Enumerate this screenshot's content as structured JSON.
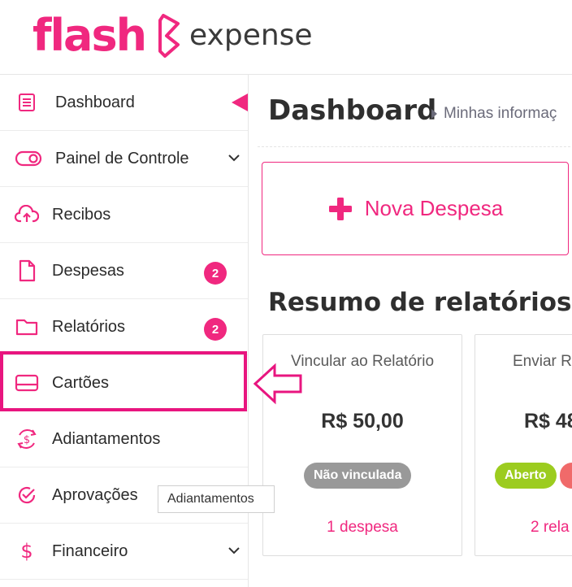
{
  "brand": {
    "name": "flash",
    "product": "expense",
    "accent": "#f0287f"
  },
  "sidebar": {
    "items": [
      {
        "label": "Dashboard",
        "icon": "list-icon"
      },
      {
        "label": "Painel de Controle",
        "icon": "toggle-icon"
      },
      {
        "label": "Recibos",
        "icon": "cloud-upload-icon"
      },
      {
        "label": "Despesas",
        "icon": "document-icon",
        "badge": "2"
      },
      {
        "label": "Relatórios",
        "icon": "folder-icon",
        "badge": "2"
      },
      {
        "label": "Cartões",
        "icon": "credit-card-icon"
      },
      {
        "label": "Adiantamentos",
        "icon": "dollar-cycle-icon"
      },
      {
        "label": "Aprovações",
        "icon": "check-circle-icon"
      },
      {
        "label": "Financeiro",
        "icon": "dollar-icon"
      }
    ],
    "tooltip": "Adiantamentos"
  },
  "main": {
    "title": "Dashboard",
    "breadcrumb": "Minhas informaç",
    "new_expense_label": "Nova Despesa",
    "summary_title": "Resumo de relatórios",
    "cards": [
      {
        "title": "Vincular ao Relatório",
        "amount": "R$ 50,00",
        "status": "Não vinculada",
        "link": "1 despesa"
      },
      {
        "title": "Enviar R",
        "amount": "R$ 48",
        "status": "Aberto",
        "link": "2 rela"
      }
    ]
  }
}
